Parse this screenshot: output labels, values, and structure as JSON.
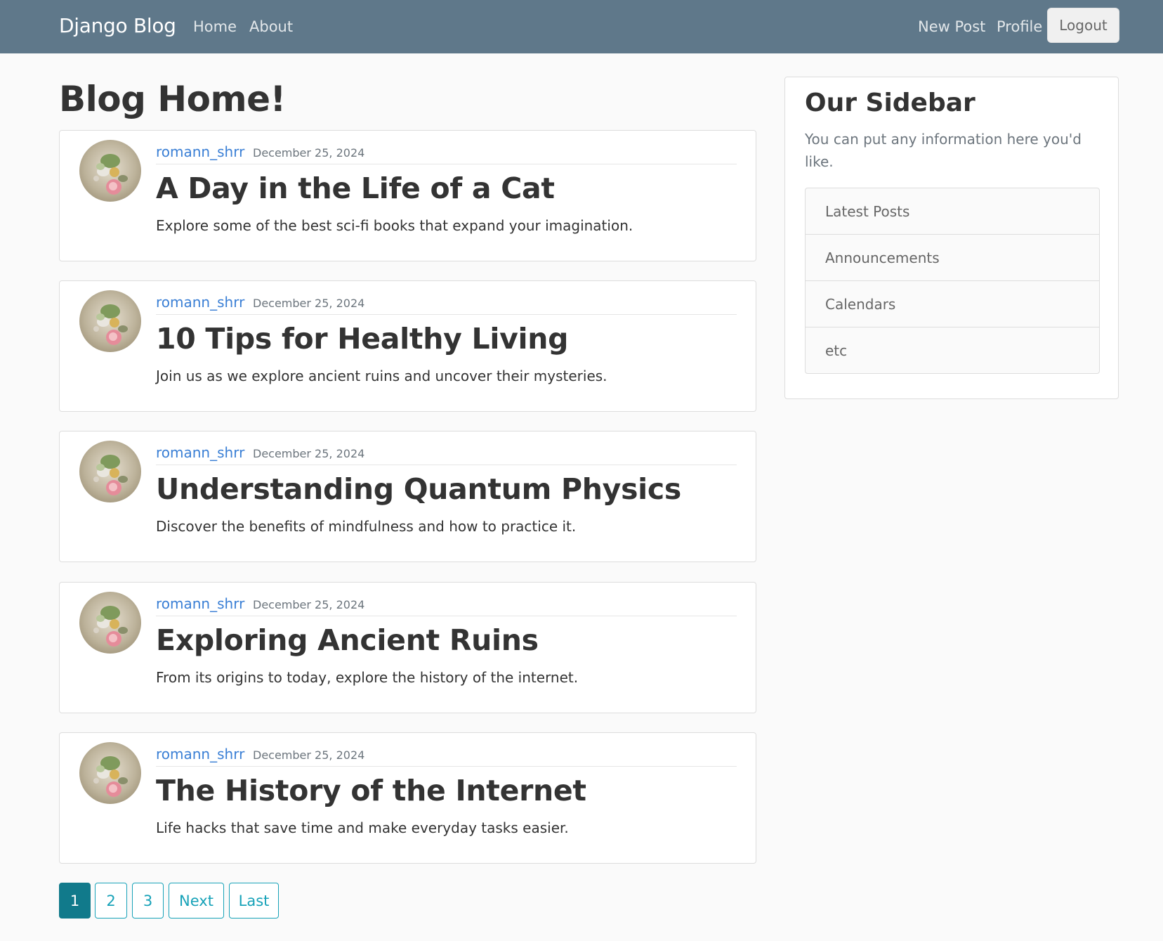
{
  "navbar": {
    "brand": "Django Blog",
    "left_links": [
      "Home",
      "About"
    ],
    "right_links": [
      "New Post",
      "Profile"
    ],
    "logout_label": "Logout"
  },
  "main": {
    "title": "Blog Home!",
    "posts": [
      {
        "author": "romann_shrr",
        "date": "December 25, 2024",
        "title": "A Day in the Life of a Cat",
        "excerpt": "Explore some of the best sci-fi books that expand your imagination."
      },
      {
        "author": "romann_shrr",
        "date": "December 25, 2024",
        "title": "10 Tips for Healthy Living",
        "excerpt": "Join us as we explore ancient ruins and uncover their mysteries."
      },
      {
        "author": "romann_shrr",
        "date": "December 25, 2024",
        "title": "Understanding Quantum Physics",
        "excerpt": "Discover the benefits of mindfulness and how to practice it."
      },
      {
        "author": "romann_shrr",
        "date": "December 25, 2024",
        "title": "Exploring Ancient Ruins",
        "excerpt": "From its origins to today, explore the history of the internet."
      },
      {
        "author": "romann_shrr",
        "date": "December 25, 2024",
        "title": "The History of the Internet",
        "excerpt": "Life hacks that save time and make everyday tasks easier."
      }
    ]
  },
  "sidebar": {
    "title": "Our Sidebar",
    "text": "You can put any information here you'd like.",
    "items": [
      "Latest Posts",
      "Announcements",
      "Calendars",
      "etc"
    ]
  },
  "pagination": {
    "pages": [
      "1",
      "2",
      "3"
    ],
    "next_label": "Next",
    "last_label": "Last",
    "current": "1"
  },
  "colors": {
    "navbar": "#5f788a",
    "link": "#3a7fd5",
    "pagination_accent": "#17a2b8",
    "pagination_active": "#117a8b"
  }
}
